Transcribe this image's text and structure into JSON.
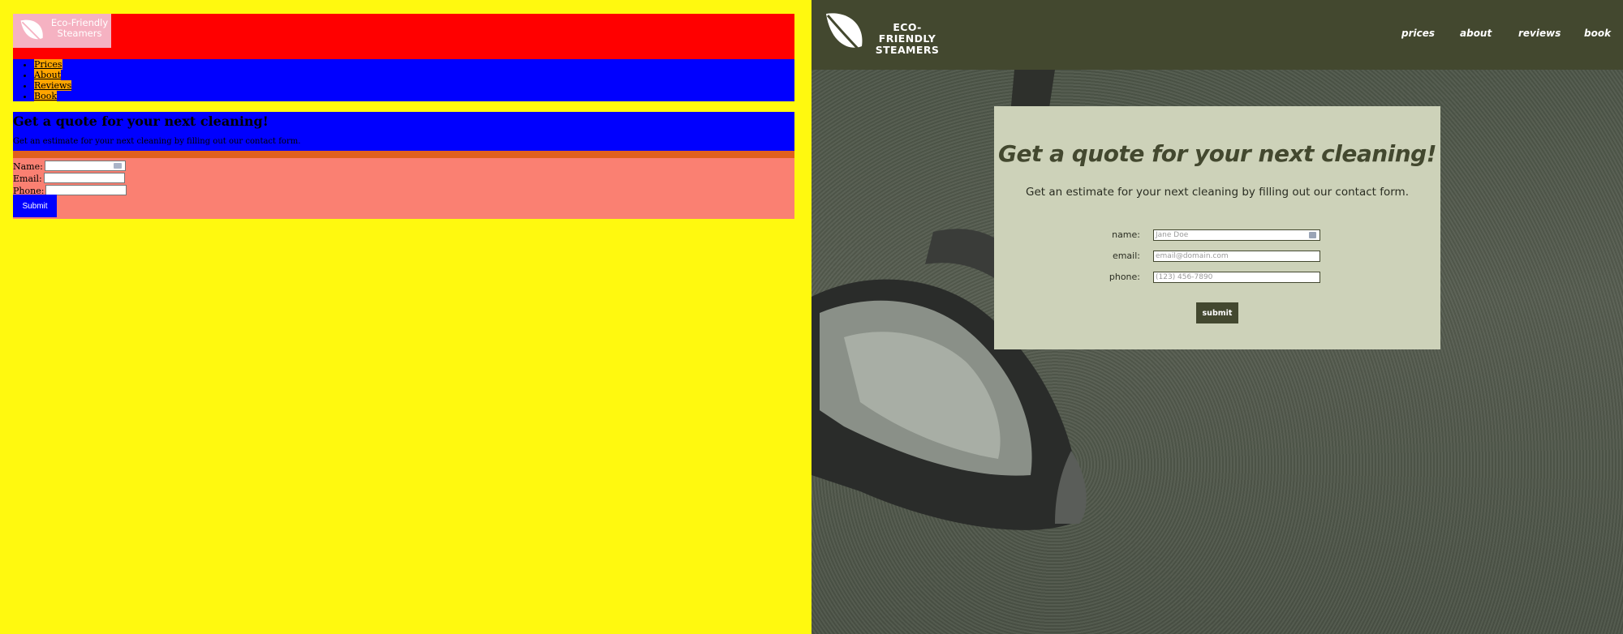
{
  "brand": {
    "name_line1": "Eco-Friendly",
    "name_line2": "Steamers",
    "name_line1_caps": "ECO-FRIENDLY",
    "name_line2_caps": "STEAMERS"
  },
  "colors": {
    "debug_bg": "#fff90f",
    "debug_header": "#ff0000",
    "debug_nav": "#0000ff",
    "debug_form": "#fa8072",
    "site_header": "#43482f",
    "site_card": "#cdd2b9"
  },
  "left": {
    "nav": [
      "Prices",
      "About",
      "Reviews",
      "Book"
    ],
    "heading": "Get a quote for your next cleaning!",
    "intro": "Get an estimate for your next cleaning by filling out our contact form.",
    "labels": {
      "name": "Name:",
      "email": "Email:",
      "phone": "Phone:"
    },
    "submit": "Submit"
  },
  "right": {
    "nav": [
      "prices",
      "about",
      "reviews",
      "book"
    ],
    "heading": "Get a quote for your next cleaning!",
    "intro": "Get an estimate for your next cleaning by filling out our contact form.",
    "labels": {
      "name": "name:",
      "email": "email:",
      "phone": "phone:"
    },
    "placeholders": {
      "name": "Jane Doe",
      "email": "email@domain.com",
      "phone": "(123) 456-7890"
    },
    "submit": "submit"
  }
}
